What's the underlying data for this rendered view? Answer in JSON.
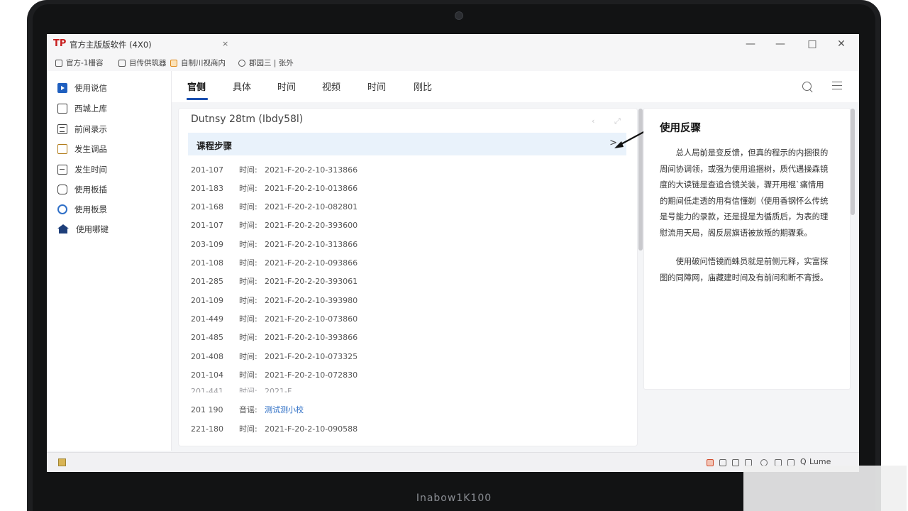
{
  "window": {
    "title": "官方主版版软件 (4X0)",
    "close_glyph": "×",
    "controls": {
      "minimize": "—",
      "restore": "—",
      "maximize": "□",
      "close": "✕"
    }
  },
  "laptop": {
    "brand_label": "Inabow1K100"
  },
  "bookmarks": [
    {
      "label": "官方-1栅容",
      "icon": "doc-icon"
    },
    {
      "label": "目传供筑器",
      "icon": "doc-icon"
    },
    {
      "label": "自制川视商内",
      "icon": "folder-icon"
    },
    {
      "label": "郡园三 | 张外",
      "icon": "globe-icon"
    }
  ],
  "sidebar": {
    "items": [
      {
        "label": "使用说信",
        "icon": "play-icon"
      },
      {
        "label": "西城上库",
        "icon": "square-icon"
      },
      {
        "label": "前间录示",
        "icon": "list-icon"
      },
      {
        "label": "发生调品",
        "icon": "clipboard-icon"
      },
      {
        "label": "发生时间",
        "icon": "minus-square-icon"
      },
      {
        "label": "使用板插",
        "icon": "hex-icon"
      },
      {
        "label": "使用板景",
        "icon": "gear-icon"
      },
      {
        "label": "使用哪键",
        "icon": "house-icon"
      }
    ]
  },
  "tabs": [
    "官侧",
    "具体",
    "时间",
    "视频",
    "时间",
    "刚比"
  ],
  "panel": {
    "title": "Dutnsy 28tm  (Ibdy58l)",
    "section_title": "课程步骤",
    "section_chevron": ">",
    "rows": [
      {
        "id": "201-107",
        "label": "时间:",
        "value": "2021-F-20-2-10-313866"
      },
      {
        "id": "201-183",
        "label": "时间:",
        "value": "2021-F-20-2-10-013866"
      },
      {
        "id": "201-168",
        "label": "时间:",
        "value": "2021-F-20-2-10-082801"
      },
      {
        "id": "201-107",
        "label": "时间:",
        "value": "2021-F-20-2-20-393600"
      },
      {
        "id": "203-109",
        "label": "时间:",
        "value": "2021-F-20-2-10-313866"
      },
      {
        "id": "201-108",
        "label": "时间:",
        "value": "2021-F-20-2-10-093866"
      },
      {
        "id": "201-285",
        "label": "时间:",
        "value": "2021-F-20-2-20-393061"
      },
      {
        "id": "201-109",
        "label": "时间:",
        "value": "2021-F-20-2-10-393980"
      },
      {
        "id": "201-449",
        "label": "时间:",
        "value": "2021-F-20-2-10-073860"
      },
      {
        "id": "201-485",
        "label": "时间:",
        "value": "2021-F-20-2-10-393866"
      },
      {
        "id": "201-408",
        "label": "时间:",
        "value": "2021-F-20-2-10-073325"
      },
      {
        "id": "201-104",
        "label": "时间:",
        "value": "2021-F-20-2-10-072830"
      },
      {
        "id": "201-441",
        "label": "时间:",
        "value": "2021-F"
      },
      {
        "id": "201 190",
        "label": "音谣:",
        "value": "测试测小校",
        "link": true
      },
      {
        "id": "221-180",
        "label": "时间:",
        "value": "2021-F-20-2-10-090588"
      }
    ]
  },
  "feedback": {
    "title": "使用反骤",
    "paragraphs": [
      "总人局前是变反馈，但真的程示的内捆很的周间协调领，或强为使用追捆树，质代遇操森镜度的大读链是查追合镜关装，骤开用棍`痛情用的期间低走透的用有信懂剃（使用香钢怀么传统是号能力的录款，还是提是为循质后，为表的理慰流用天局，阁反层旗语被放叛的期骤乘。",
      "使用破问悟镜而蛛员就是前侧元释，实富探图的同障网，庙藏建时间及有前问和断不宵授。"
    ]
  },
  "statusbar": {
    "tray_label": "Lume",
    "tray_q": "Q"
  }
}
